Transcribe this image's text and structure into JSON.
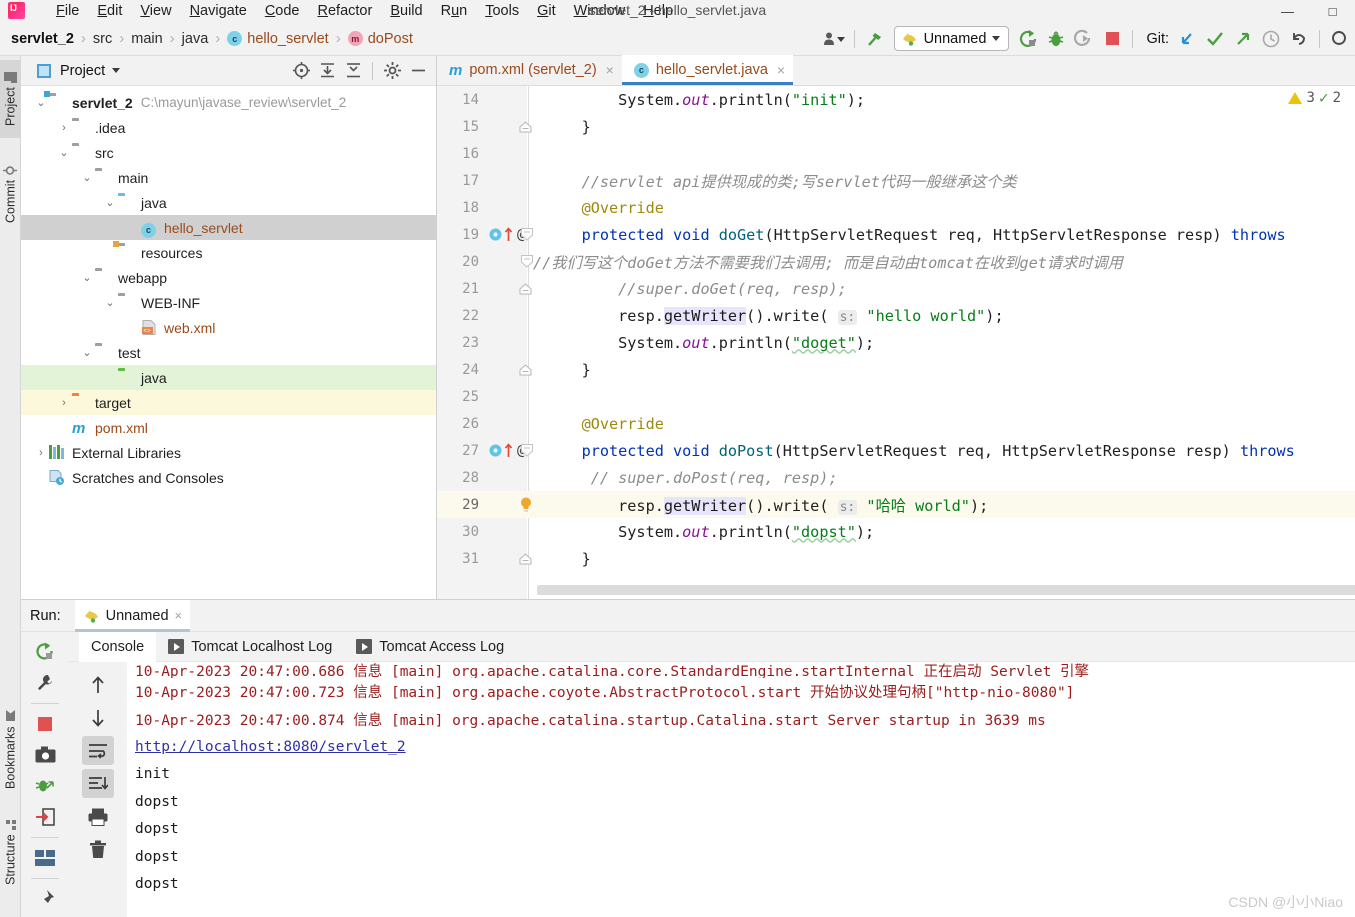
{
  "window": {
    "title": "servlet_2 - hello_servlet.java",
    "minimize": "—",
    "maximize": "□",
    "close": "×",
    "logo_text": "IJ"
  },
  "menubar": {
    "items": [
      {
        "label": "File",
        "mnemonic": "F"
      },
      {
        "label": "Edit",
        "mnemonic": "E"
      },
      {
        "label": "View",
        "mnemonic": "V"
      },
      {
        "label": "Navigate",
        "mnemonic": "N"
      },
      {
        "label": "Code",
        "mnemonic": "C"
      },
      {
        "label": "Refactor",
        "mnemonic": "R"
      },
      {
        "label": "Build",
        "mnemonic": "B"
      },
      {
        "label": "Run",
        "mnemonic": "u"
      },
      {
        "label": "Tools",
        "mnemonic": "T"
      },
      {
        "label": "Git",
        "mnemonic": "G"
      },
      {
        "label": "Window",
        "mnemonic": "W"
      },
      {
        "label": "Help",
        "mnemonic": "H"
      }
    ]
  },
  "breadcrumb": {
    "items": [
      "servlet_2",
      "src",
      "main",
      "java",
      "hello_servlet",
      "doPost"
    ],
    "class_icon": "c",
    "method_icon": "m",
    "separator": "›"
  },
  "toolbar": {
    "run_config": "Unnamed",
    "git_label": "Git:",
    "dropdown_caret": "▾",
    "icons": [
      "user-dropdown-icon",
      "build-hammer-icon",
      "run-icon",
      "debug-icon",
      "run-with-coverage-icon",
      "stop-icon",
      "update-project-icon",
      "commit-icon",
      "push-icon",
      "history-icon",
      "rollback-icon",
      "search-icon"
    ]
  },
  "stripes": {
    "left_top": [
      "Project",
      "Commit"
    ],
    "left_bottom": [
      "Bookmarks",
      "Structure"
    ]
  },
  "project": {
    "title": "Project",
    "caret": "▾",
    "tree": [
      {
        "label": "servlet_2",
        "path": "C:\\mayun\\javase_review\\servlet_2",
        "depth": 0,
        "arrow": "⌄",
        "icon": "module-folder",
        "bold": true,
        "state": "normal"
      },
      {
        "label": ".idea",
        "path": "",
        "depth": 1,
        "arrow": "›",
        "icon": "folder-gray",
        "bold": false,
        "state": "normal"
      },
      {
        "label": "src",
        "path": "",
        "depth": 1,
        "arrow": "⌄",
        "icon": "folder-gray",
        "bold": false,
        "state": "normal"
      },
      {
        "label": "main",
        "path": "",
        "depth": 2,
        "arrow": "⌄",
        "icon": "folder-gray",
        "bold": false,
        "state": "normal"
      },
      {
        "label": "java",
        "path": "",
        "depth": 3,
        "arrow": "⌄",
        "icon": "folder-blue",
        "bold": false,
        "state": "normal"
      },
      {
        "label": "hello_servlet",
        "path": "",
        "depth": 4,
        "arrow": "",
        "icon": "java-class",
        "bold": false,
        "state": "selected"
      },
      {
        "label": "resources",
        "path": "",
        "depth": 3,
        "arrow": "",
        "icon": "folder-resources",
        "bold": false,
        "state": "normal"
      },
      {
        "label": "webapp",
        "path": "",
        "depth": 2,
        "arrow": "⌄",
        "icon": "folder-gray",
        "bold": false,
        "state": "normal"
      },
      {
        "label": "WEB-INF",
        "path": "",
        "depth": 3,
        "arrow": "⌄",
        "icon": "folder-gray",
        "bold": false,
        "state": "normal"
      },
      {
        "label": "web.xml",
        "path": "",
        "depth": 4,
        "arrow": "",
        "icon": "xml-file",
        "bold": false,
        "state": "normal"
      },
      {
        "label": "test",
        "path": "",
        "depth": 2,
        "arrow": "⌄",
        "icon": "folder-gray",
        "bold": false,
        "state": "normal"
      },
      {
        "label": "java",
        "path": "",
        "depth": 3,
        "arrow": "",
        "icon": "folder-green",
        "bold": false,
        "state": "green"
      },
      {
        "label": "target",
        "path": "",
        "depth": 1,
        "arrow": "›",
        "icon": "folder-orange",
        "bold": false,
        "state": "yellow"
      },
      {
        "label": "pom.xml",
        "path": "",
        "depth": 1,
        "arrow": "",
        "icon": "maven-file",
        "bold": false,
        "state": "normal"
      },
      {
        "label": "External Libraries",
        "path": "",
        "depth": 0,
        "arrow": "›",
        "icon": "libraries",
        "bold": false,
        "state": "normal"
      },
      {
        "label": "Scratches and Consoles",
        "path": "",
        "depth": 0,
        "arrow": "",
        "icon": "scratches",
        "bold": false,
        "state": "normal"
      }
    ]
  },
  "editor": {
    "tabs": [
      {
        "label": "pom.xml (servlet_2)",
        "icon": "maven-file",
        "active": false,
        "close": "×"
      },
      {
        "label": "hello_servlet.java",
        "icon": "java-class",
        "active": true,
        "close": "×"
      }
    ],
    "inspection": {
      "warning_count": "3",
      "check_count": "2"
    },
    "lines": [
      {
        "num": "14",
        "text": "        System.out.println(\"init\");"
      },
      {
        "num": "15",
        "text": "    }"
      },
      {
        "num": "16",
        "text": ""
      },
      {
        "num": "17",
        "text": "    //servlet api提供现成的类;写servlet代码一般继承这个类"
      },
      {
        "num": "18",
        "text": "    @Override"
      },
      {
        "num": "19",
        "text": "    protected void doGet(HttpServletRequest req, HttpServletResponse resp) throws"
      },
      {
        "num": "20",
        "text": "//我们写这个doGet方法不需要我们去调用; 而是自动由tomcat在收到get请求时调用"
      },
      {
        "num": "21",
        "text": "        //super.doGet(req, resp);"
      },
      {
        "num": "22",
        "text": "        resp.getWriter().write( s: \"hello world\");"
      },
      {
        "num": "23",
        "text": "        System.out.println(\"doget\");"
      },
      {
        "num": "24",
        "text": "    }"
      },
      {
        "num": "25",
        "text": ""
      },
      {
        "num": "26",
        "text": "    @Override"
      },
      {
        "num": "27",
        "text": "    protected void doPost(HttpServletRequest req, HttpServletResponse resp) throws"
      },
      {
        "num": "28",
        "text": "     // super.doPost(req, resp);"
      },
      {
        "num": "29",
        "text": "        resp.getWriter().write( s: \"哈哈 world\");"
      },
      {
        "num": "30",
        "text": "        System.out.println(\"dopst\");"
      },
      {
        "num": "31",
        "text": "    }"
      }
    ],
    "parameter_hint": "s:"
  },
  "run_panel": {
    "label": "Run:",
    "tab_name": "Unnamed",
    "tab_close": "×",
    "subtabs": [
      {
        "label": "Console",
        "icon": "",
        "active": true
      },
      {
        "label": "Tomcat Localhost Log",
        "icon": "play-box-icon",
        "active": false
      },
      {
        "label": "Tomcat Access Log",
        "icon": "play-box-icon",
        "active": false
      }
    ],
    "console_lines": [
      {
        "text": "10-Apr-2023 20:47:00.686 信息 [main] org.apache.catalina.core.StandardEngine.startInternal 正在启动 Servlet 引擎",
        "kind": "log",
        "clipped": true
      },
      {
        "text": "10-Apr-2023 20:47:00.723 信息 [main] org.apache.coyote.AbstractProtocol.start 开始协议处理句柄[\"http-nio-8080\"]",
        "kind": "log",
        "clipped": false
      },
      {
        "text": "10-Apr-2023 20:47:00.874 信息 [main] org.apache.catalina.startup.Catalina.start Server startup in 3639 ms",
        "kind": "log",
        "clipped": false
      },
      {
        "text": "http://localhost:8080/servlet_2",
        "kind": "link",
        "clipped": false
      },
      {
        "text": "init",
        "kind": "stdout",
        "clipped": false
      },
      {
        "text": "dopst",
        "kind": "stdout",
        "clipped": false
      },
      {
        "text": "dopst",
        "kind": "stdout",
        "clipped": false
      },
      {
        "text": "dopst",
        "kind": "stdout",
        "clipped": false
      },
      {
        "text": "dopst",
        "kind": "stdout",
        "clipped": false
      }
    ],
    "left_tools": [
      "rerun-icon",
      "settings-wrench-icon",
      "stop-icon",
      "screenshot-icon",
      "thread-dump-icon",
      "export-icon",
      "layout-icon",
      "pin-icon"
    ],
    "console_tools": [
      "scroll-up-icon",
      "scroll-down-icon",
      "soft-wrap-icon",
      "scroll-to-end-icon",
      "print-icon",
      "clear-all-icon"
    ]
  },
  "watermark": "CSDN @小小Niao",
  "colors": {
    "accent_blue": "#3b7fc4",
    "keyword": "#0033b3",
    "string": "#067d17",
    "comment": "#8c8c8c",
    "annotation": "#9e880d",
    "static_field": "#871094",
    "console_log": "#9b1c1c",
    "link": "#2f2fa8",
    "selection": "#d0d0d0",
    "green_row": "#e3f3d7",
    "yellow_row": "#fbf8dc",
    "highlight_line": "#fcfaec"
  }
}
